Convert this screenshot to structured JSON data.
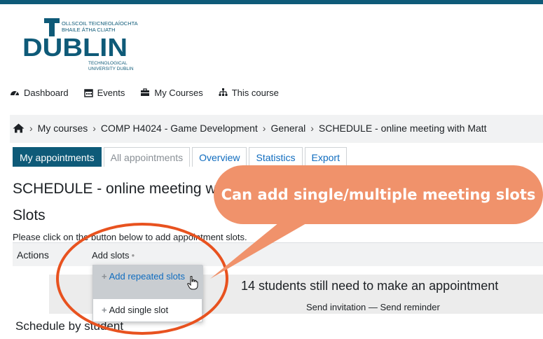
{
  "logo": {
    "big_text_top": "T",
    "big_text": "DUBLIN",
    "line1": "OLLSCOIL TEICNEOLAÍOCHTA",
    "line2": "BHAILE ÁTHA CLIATH",
    "line3": "TECHNOLOGICAL",
    "line4": "UNIVERSITY DUBLIN",
    "color": "#0e5a78"
  },
  "nav": {
    "items": [
      {
        "label": "Dashboard",
        "icon": "dashboard-icon"
      },
      {
        "label": "Events",
        "icon": "calendar-icon"
      },
      {
        "label": "My Courses",
        "icon": "briefcase-icon"
      },
      {
        "label": "This course",
        "icon": "sitemap-icon"
      }
    ]
  },
  "breadcrumb": {
    "home_icon": "home-icon",
    "items": [
      "My courses",
      "COMP H4024 - Game Development",
      "General",
      "SCHEDULE - online meeting with Matt"
    ]
  },
  "tabs": [
    "My appointments",
    "All appointments",
    "Overview",
    "Statistics",
    "Export"
  ],
  "page": {
    "title": "SCHEDULE - online meeting w",
    "slots_heading": "Slots",
    "instruction": "Please click on the button below to add appointment slots.",
    "actions_label": "Actions",
    "add_slots": "Add slots",
    "students_text": "14 students still need to make an appointment",
    "send_links": "Send invitation — Send reminder",
    "schedule_by": "Schedule by student"
  },
  "dropdown": {
    "items": [
      "Add repeated slots",
      "Add single slot"
    ]
  },
  "callout": {
    "text": "Can add single/multiple meeting slots",
    "color": "#f0926b"
  },
  "annotation": {
    "ellipse_color": "#e8521f"
  },
  "colors": {
    "primary": "#0e5a78",
    "link": "#0f6cbf"
  }
}
